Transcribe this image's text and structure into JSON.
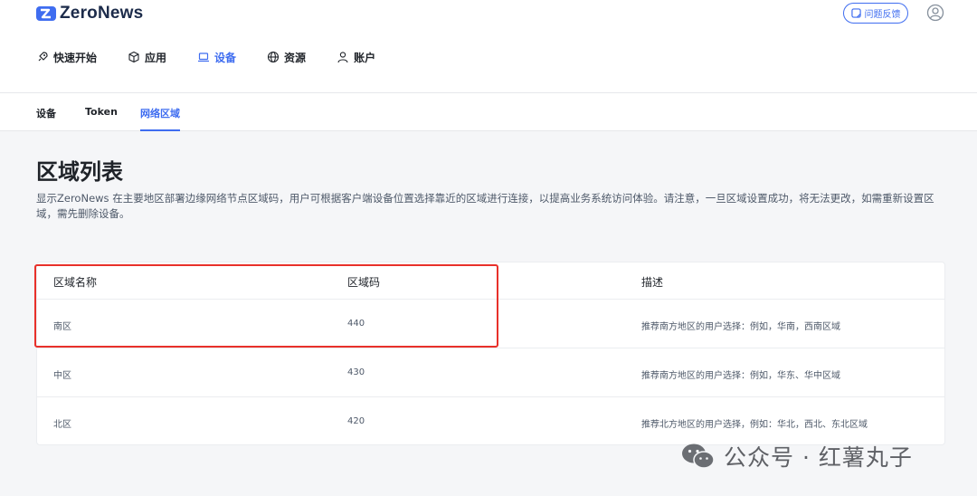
{
  "app": {
    "logo_text": "ZeroNews"
  },
  "header": {
    "feedback_label": "问题反馈",
    "nav": [
      {
        "label": "快速开始",
        "icon": "rocket-icon"
      },
      {
        "label": "应用",
        "icon": "cube-icon"
      },
      {
        "label": "设备",
        "icon": "laptop-icon",
        "active": true
      },
      {
        "label": "资源",
        "icon": "globe-icon"
      },
      {
        "label": "账户",
        "icon": "user-icon"
      }
    ]
  },
  "subnav": {
    "tabs": [
      {
        "label": "设备"
      },
      {
        "label": "Token"
      },
      {
        "label": "网络区域",
        "active": true
      }
    ]
  },
  "main": {
    "title": "区域列表",
    "description": "显示ZeroNews 在主要地区部署边缘网络节点区域码，用户可根据客户端设备位置选择靠近的区域进行连接，以提高业务系统访问体验。请注意，一旦区域设置成功，将无法更改，如需重新设置区域，需先删除设备。"
  },
  "table": {
    "columns": [
      "区域名称",
      "区域码",
      "描述"
    ],
    "rows": [
      {
        "name": "南区",
        "code": "440",
        "desc": "推荐南方地区的用户选择：例如，华南，西南区域"
      },
      {
        "name": "中区",
        "code": "430",
        "desc": "推荐南方地区的用户选择：例如，华东、华中区域"
      },
      {
        "name": "北区",
        "code": "420",
        "desc": "推荐北方地区的用户选择，例如：华北，西北、东北区域"
      }
    ]
  },
  "watermark": {
    "text": "公众号 · 红薯丸子"
  },
  "colors": {
    "accent": "#3f6df0",
    "highlight": "#e8302a",
    "page_bg": "#f5f6f8"
  }
}
